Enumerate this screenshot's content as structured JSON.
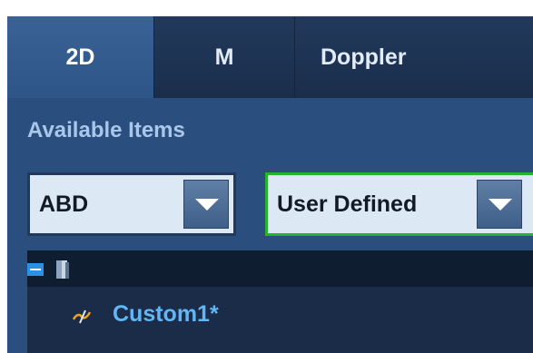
{
  "tabs": [
    {
      "label": "2D",
      "active": true
    },
    {
      "label": "M",
      "active": false
    },
    {
      "label": "Doppler",
      "active": false
    }
  ],
  "available_items": {
    "title": "Available Items"
  },
  "selects": {
    "exam": {
      "value": "ABD"
    },
    "preset": {
      "value": "User Defined",
      "highlighted": true,
      "highlight_color": "#26b42c"
    }
  },
  "tree": {
    "items": [
      {
        "label": "Custom1*",
        "icon": "custom-pen-icon"
      }
    ]
  },
  "colors": {
    "panel_bg": "#2a4e7e",
    "tab_bar_bg": "#1c2f4c",
    "accent_text": "#62b6f4",
    "title_text": "#a9c7ea"
  }
}
